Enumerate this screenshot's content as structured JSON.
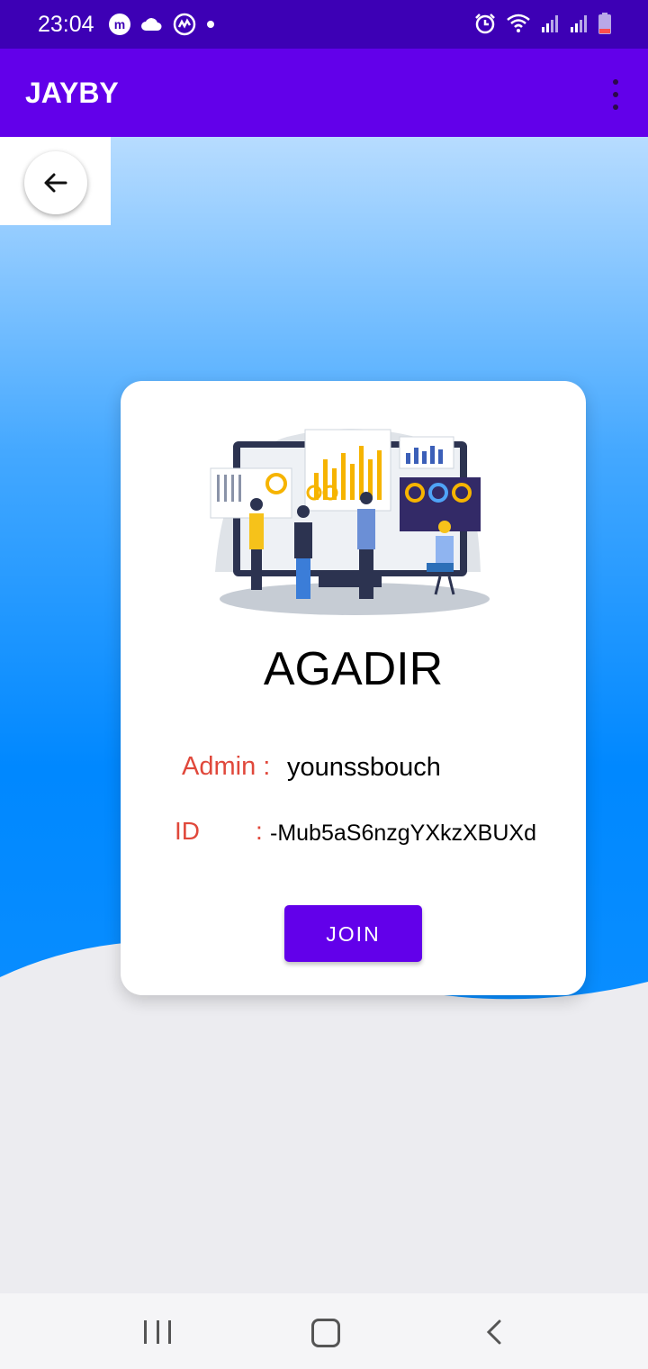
{
  "status_bar": {
    "time": "23:04",
    "left_icons": [
      "m-app-icon",
      "cloud-icon",
      "coin-app-icon",
      "dot-icon"
    ],
    "right_icons": [
      "alarm-icon",
      "wifi-icon",
      "signal-icon",
      "signal-icon",
      "battery-icon"
    ],
    "battery_color": "#ff4d4d"
  },
  "app_bar": {
    "title": "JAYBY",
    "overflow_icon": "more-vert-icon",
    "color": "#6200ea"
  },
  "back_button": {
    "icon": "arrow-left-icon"
  },
  "card": {
    "illustration": "analytics-team-illustration",
    "city": "AGADIR",
    "admin_label": "Admin :",
    "admin_value": "younssbouch",
    "id_label": "ID",
    "id_separator": ":",
    "id_value": "-Mub5aS6nzgYXkzXBUXd",
    "join_label": "JOIN",
    "label_color": "#e0483b"
  },
  "nav_bar": {
    "icons": [
      "recent-apps-icon",
      "home-icon",
      "back-icon"
    ]
  }
}
